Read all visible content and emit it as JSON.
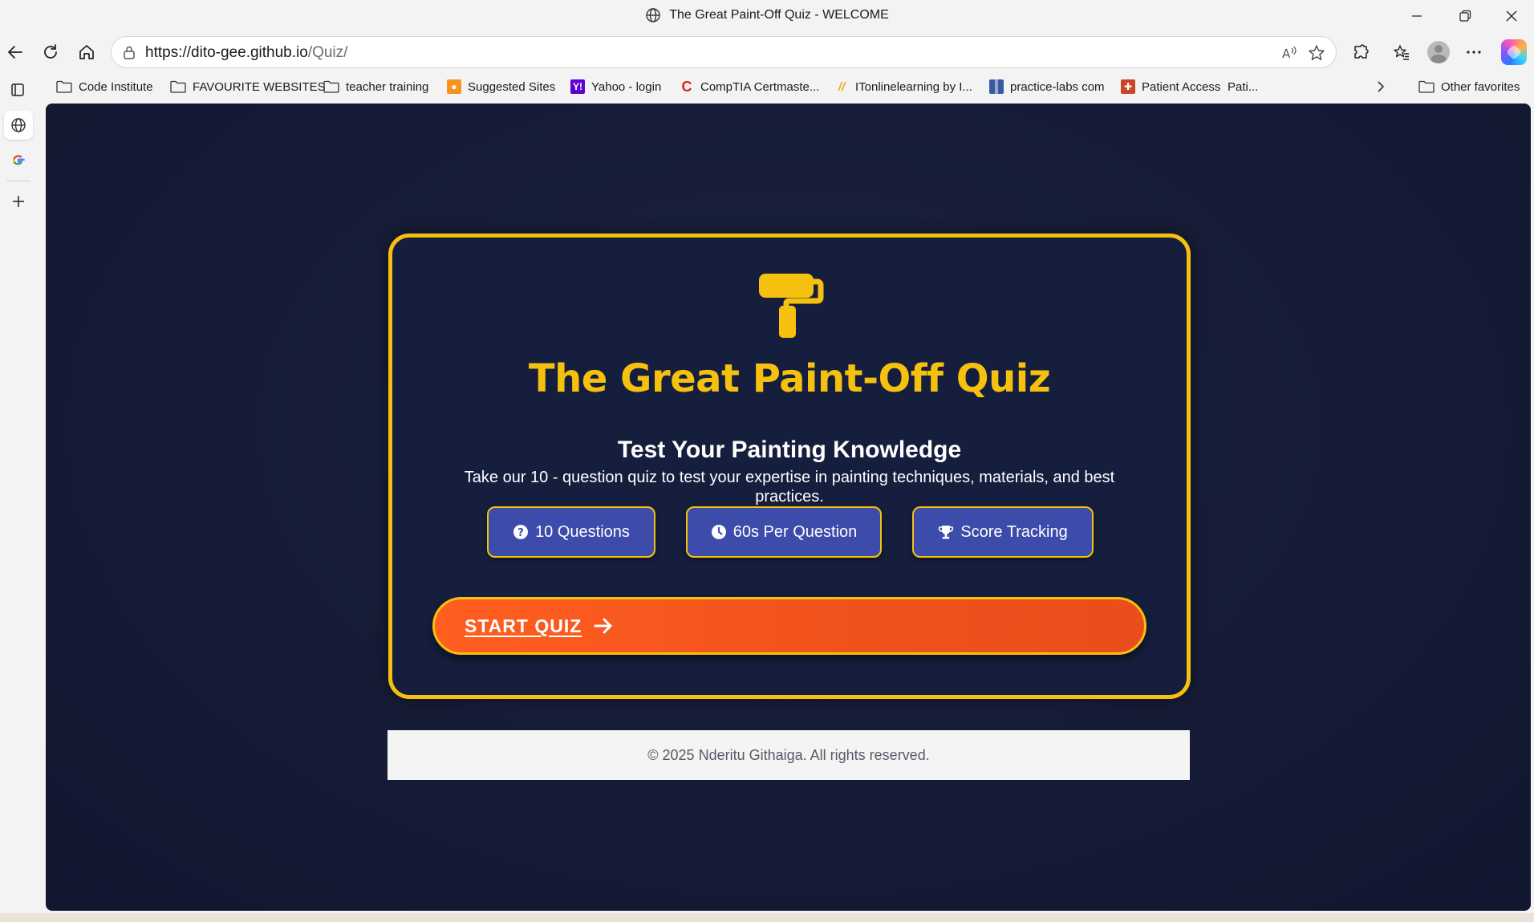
{
  "window": {
    "title": "The Great Paint-Off Quiz - WELCOME"
  },
  "addressbar": {
    "url_host": "https://dito-gee.github.io",
    "url_path": "/Quiz/"
  },
  "favorites": [
    {
      "label": "Code Institute",
      "icon": "folder-icon"
    },
    {
      "label": "FAVOURITE WEBSITES",
      "icon": "folder-icon"
    },
    {
      "label": "teacher training",
      "icon": "folder-icon"
    },
    {
      "label": "Suggested Sites",
      "icon": "suggested-sites-icon",
      "color": "#f7931e"
    },
    {
      "label": "Yahoo - login",
      "icon": "yahoo-icon",
      "color": "#6001d2"
    },
    {
      "label": "CompTIA Certmaste...",
      "icon": "comptia-icon",
      "color": "#e2231a"
    },
    {
      "label": "ITonlinelearning by I...",
      "icon": "itonline-icon",
      "color": "#f5a623"
    },
    {
      "label": "practice-labs com",
      "icon": "practice-labs-icon",
      "color": "#3b5aa6"
    },
    {
      "label": "Patient Access",
      "icon": "patient-access-icon",
      "color": "#c8472b"
    },
    {
      "label": "Pati...",
      "icon": "none"
    }
  ],
  "favorites_other": "Other favorites",
  "page": {
    "title": "The Great Paint-Off Quiz",
    "subtitle": "Test Your Painting Knowledge",
    "description": "Take our 10 - question quiz to test your expertise in painting techniques, materials, and best practices.",
    "features": [
      {
        "label": "10 Questions",
        "icon": "question-circle-icon"
      },
      {
        "label": "60s Per Question",
        "icon": "clock-icon"
      },
      {
        "label": "Score Tracking",
        "icon": "trophy-icon"
      }
    ],
    "start_label": "START QUIZ",
    "footer": "© 2025 Nderitu Githaiga. All rights reserved."
  },
  "colors": {
    "accent": "#f5c10e",
    "background": "#161c36",
    "pill": "#3d4bab",
    "start_button": "#f0521c"
  }
}
